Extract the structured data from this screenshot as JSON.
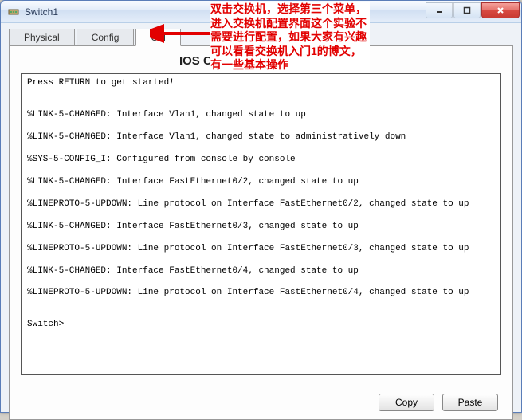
{
  "window": {
    "title": "Switch1"
  },
  "tabs": {
    "physical": "Physical",
    "config": "Config",
    "cli": "CLI"
  },
  "cli": {
    "heading": "IOS Command Line Interface",
    "lines": [
      "Press RETURN to get started!",
      "",
      "",
      "%LINK-5-CHANGED: Interface Vlan1, changed state to up",
      "",
      "%LINK-5-CHANGED: Interface Vlan1, changed state to administratively down",
      "",
      "%SYS-5-CONFIG_I: Configured from console by console",
      "",
      "%LINK-5-CHANGED: Interface FastEthernet0/2, changed state to up",
      "",
      "%LINEPROTO-5-UPDOWN: Line protocol on Interface FastEthernet0/2, changed state to up",
      "",
      "%LINK-5-CHANGED: Interface FastEthernet0/3, changed state to up",
      "",
      "%LINEPROTO-5-UPDOWN: Line protocol on Interface FastEthernet0/3, changed state to up",
      "",
      "%LINK-5-CHANGED: Interface FastEthernet0/4, changed state to up",
      "",
      "%LINEPROTO-5-UPDOWN: Line protocol on Interface FastEthernet0/4, changed state to up",
      "",
      "",
      "Switch>"
    ]
  },
  "buttons": {
    "copy": "Copy",
    "paste": "Paste"
  },
  "annotation": {
    "text": "双击交换机，选择第三个菜单，进入交换机配置界面这个实验不需要进行配置，如果大家有兴趣可以看看交换机入门1的博文，有一些基本操作",
    "arrow_color": "#e20000"
  }
}
